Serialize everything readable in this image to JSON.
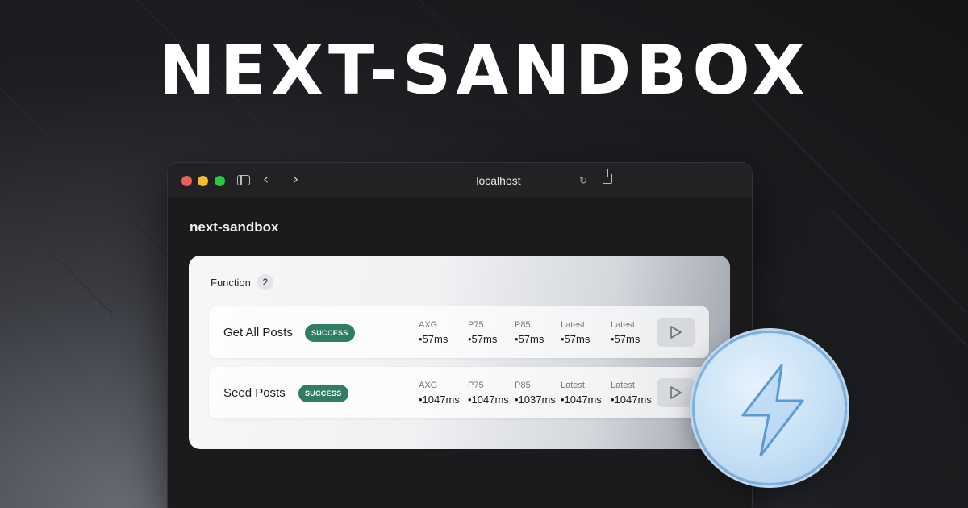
{
  "hero": {
    "title": "NEXT-SANDBOX"
  },
  "browser": {
    "url": "localhost",
    "back_glyph": "‹",
    "forward_glyph": "›",
    "reload_glyph": "↻"
  },
  "page": {
    "site_title": "next-sandbox",
    "section": {
      "label": "Function",
      "count": "2"
    },
    "functions": [
      {
        "name": "Get All Posts",
        "status": "SUCCESS",
        "metrics": [
          {
            "label": "AXG",
            "value": "•57ms"
          },
          {
            "label": "P75",
            "value": "•57ms"
          },
          {
            "label": "P85",
            "value": "•57ms"
          },
          {
            "label": "Latest",
            "value": "•57ms"
          },
          {
            "label": "Latest",
            "value": "•57ms"
          }
        ]
      },
      {
        "name": "Seed Posts",
        "status": "SUCCESS",
        "metrics": [
          {
            "label": "AXG",
            "value": "•1047ms"
          },
          {
            "label": "P75",
            "value": "•1047ms"
          },
          {
            "label": "P85",
            "value": "•1037ms"
          },
          {
            "label": "Latest",
            "value": "•1047ms"
          },
          {
            "label": "Latest",
            "value": "•1047ms"
          }
        ]
      }
    ]
  },
  "colors": {
    "status_success": "#2f7d62",
    "accent_blue": "#7fb1de"
  },
  "icons": {
    "sidebar": "sidebar-toggle-icon",
    "share": "share-icon",
    "play": "play-icon",
    "bolt": "lightning-bolt-icon"
  }
}
